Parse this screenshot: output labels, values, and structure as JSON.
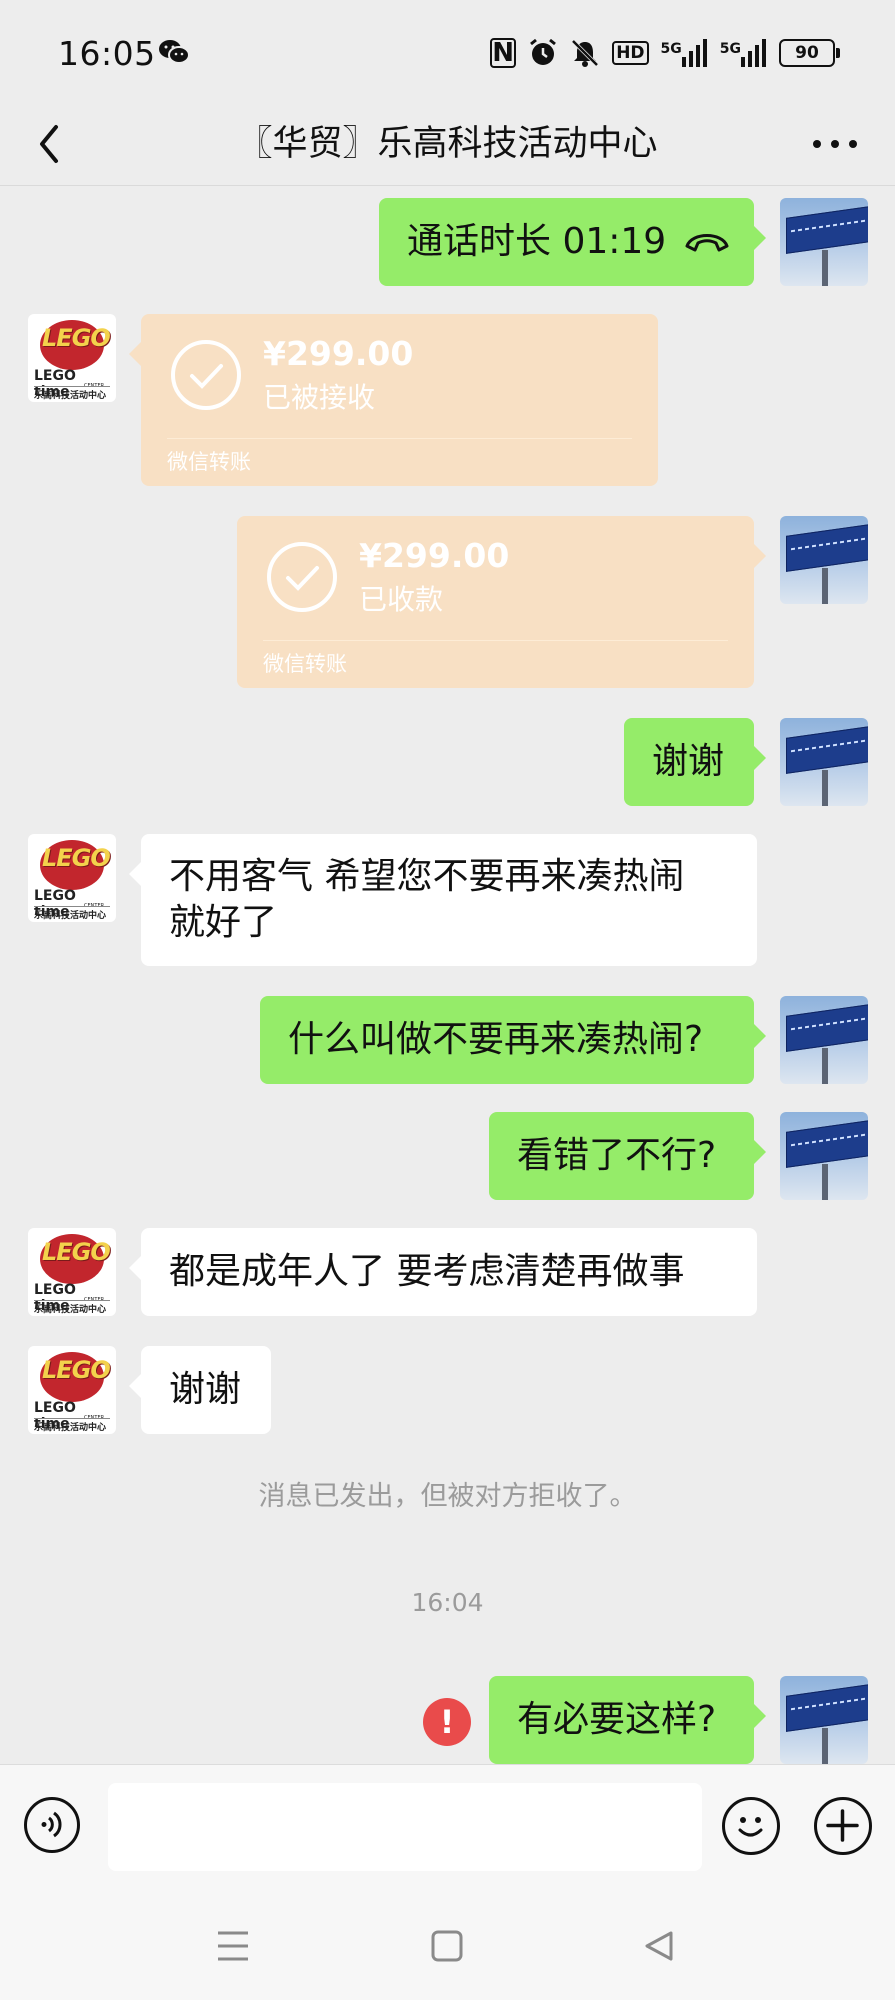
{
  "status_bar": {
    "time": "16:05",
    "battery": "90",
    "hd": "HD",
    "net1": "5G",
    "net2": "5G",
    "nfc": "N",
    "icons": [
      "wechat-icon",
      "nfc-icon",
      "alarm-icon",
      "mute-icon",
      "hd-icon",
      "signal-icon",
      "signal-icon",
      "battery-icon"
    ]
  },
  "header": {
    "title": "〖华贸〗乐高科技活动中心",
    "back_icon": "chevron-left-icon",
    "more_icon": "more-icon"
  },
  "avatars": {
    "lego_letters": "LEGO",
    "lego_time": "LEGO time",
    "lego_center": "CENTER",
    "lego_cn": "乐高科技活动中心"
  },
  "messages": [
    {
      "from": "me",
      "type": "call",
      "text": "通话时长 01:19"
    },
    {
      "from": "them",
      "type": "transfer",
      "amount": "¥299.00",
      "status": "已被接收",
      "footer": "微信转账"
    },
    {
      "from": "me",
      "type": "transfer",
      "amount": "¥299.00",
      "status": "已收款",
      "footer": "微信转账"
    },
    {
      "from": "me",
      "type": "text",
      "text": "谢谢"
    },
    {
      "from": "them",
      "type": "text",
      "line1": "不用客气 希望您不要再来凑热闹",
      "line2": "就好了"
    },
    {
      "from": "me",
      "type": "text",
      "text": "什么叫做不要再来凑热闹?"
    },
    {
      "from": "me",
      "type": "text",
      "text": "看错了不行?"
    },
    {
      "from": "them",
      "type": "text",
      "text": "都是成年人了  要考虑清楚再做事"
    },
    {
      "from": "them",
      "type": "text",
      "text": "谢谢"
    },
    {
      "type": "system",
      "text": "消息已发出，但被对方拒收了。"
    },
    {
      "type": "timestamp",
      "text": "16:04"
    },
    {
      "from": "me",
      "type": "text",
      "text": "有必要这样?",
      "error": "!"
    }
  ],
  "input_bar": {
    "voice_icon": "voice-icon",
    "emoji_icon": "emoji-icon",
    "plus_icon": "plus-icon",
    "value": ""
  },
  "system_nav": {
    "icons": [
      "menu-icon",
      "home-icon",
      "back-triangle-icon"
    ]
  },
  "colors": {
    "background": "#ededed",
    "my_bubble": "#95ec69",
    "their_bubble": "#ffffff",
    "transfer": "#f8e0c4",
    "error": "#e94b4b"
  }
}
